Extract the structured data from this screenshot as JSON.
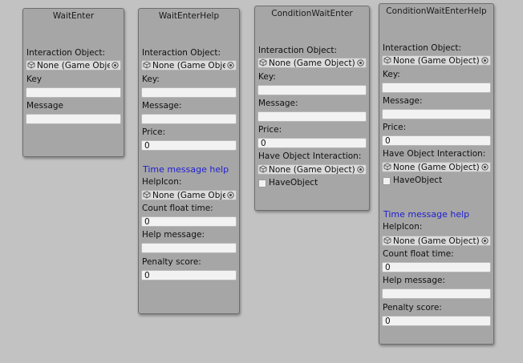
{
  "nodes": {
    "wait_enter": {
      "title": "WaitEnter",
      "interaction_label": "Interaction Object:",
      "interaction_value": "None (Game Object)",
      "key_label": "Key",
      "key_value": "",
      "message_label": "Message",
      "message_value": ""
    },
    "wait_enter_help": {
      "title": "WaitEnterHelp",
      "interaction_label": "Interaction Object:",
      "interaction_value": "None (Game Object)",
      "key_label": "Key:",
      "key_value": "",
      "message_label": "Message:",
      "message_value": "",
      "price_label": "Price:",
      "price_value": "0",
      "section_heading": "Time message help",
      "help_icon_label": "HelpIcon:",
      "help_icon_value": "None (Game Object)",
      "count_label": "Count float time:",
      "count_value": "0",
      "help_message_label": "Help message:",
      "help_message_value": "",
      "penalty_label": "Penalty score:",
      "penalty_value": "0"
    },
    "condition_wait_enter": {
      "title": "ConditionWaitEnter",
      "interaction_label": "Interaction Object:",
      "interaction_value": "None (Game Object)",
      "key_label": "Key:",
      "key_value": "",
      "message_label": "Message:",
      "message_value": "",
      "price_label": "Price:",
      "price_value": "0",
      "have_obj_label": "Have Object Interaction:",
      "have_obj_value": "None (Game Object)",
      "checkbox_label": "HaveObject"
    },
    "condition_wait_enter_help": {
      "title": "ConditionWaitEnterHelp",
      "interaction_label": "Interaction Object:",
      "interaction_value": "None (Game Object)",
      "key_label": "Key:",
      "key_value": "",
      "message_label": "Message:",
      "message_value": "",
      "price_label": "Price:",
      "price_value": "0",
      "have_obj_label": "Have Object Interaction:",
      "have_obj_value": "None (Game Object)",
      "checkbox_label": "HaveObject",
      "section_heading": "Time message help",
      "help_icon_label": "HelpIcon:",
      "help_icon_value": "None (Game Object)",
      "count_label": "Count float time:",
      "count_value": "0",
      "help_message_label": "Help message:",
      "help_message_value": "",
      "penalty_label": "Penalty score:",
      "penalty_value": "0"
    }
  },
  "icons": {
    "object_field": "cube-icon",
    "object_picker": "target-picker-icon"
  },
  "colors": {
    "canvas": "#c2c2c2",
    "node": "#a6a6a6",
    "heading": "#1e1ed2"
  }
}
